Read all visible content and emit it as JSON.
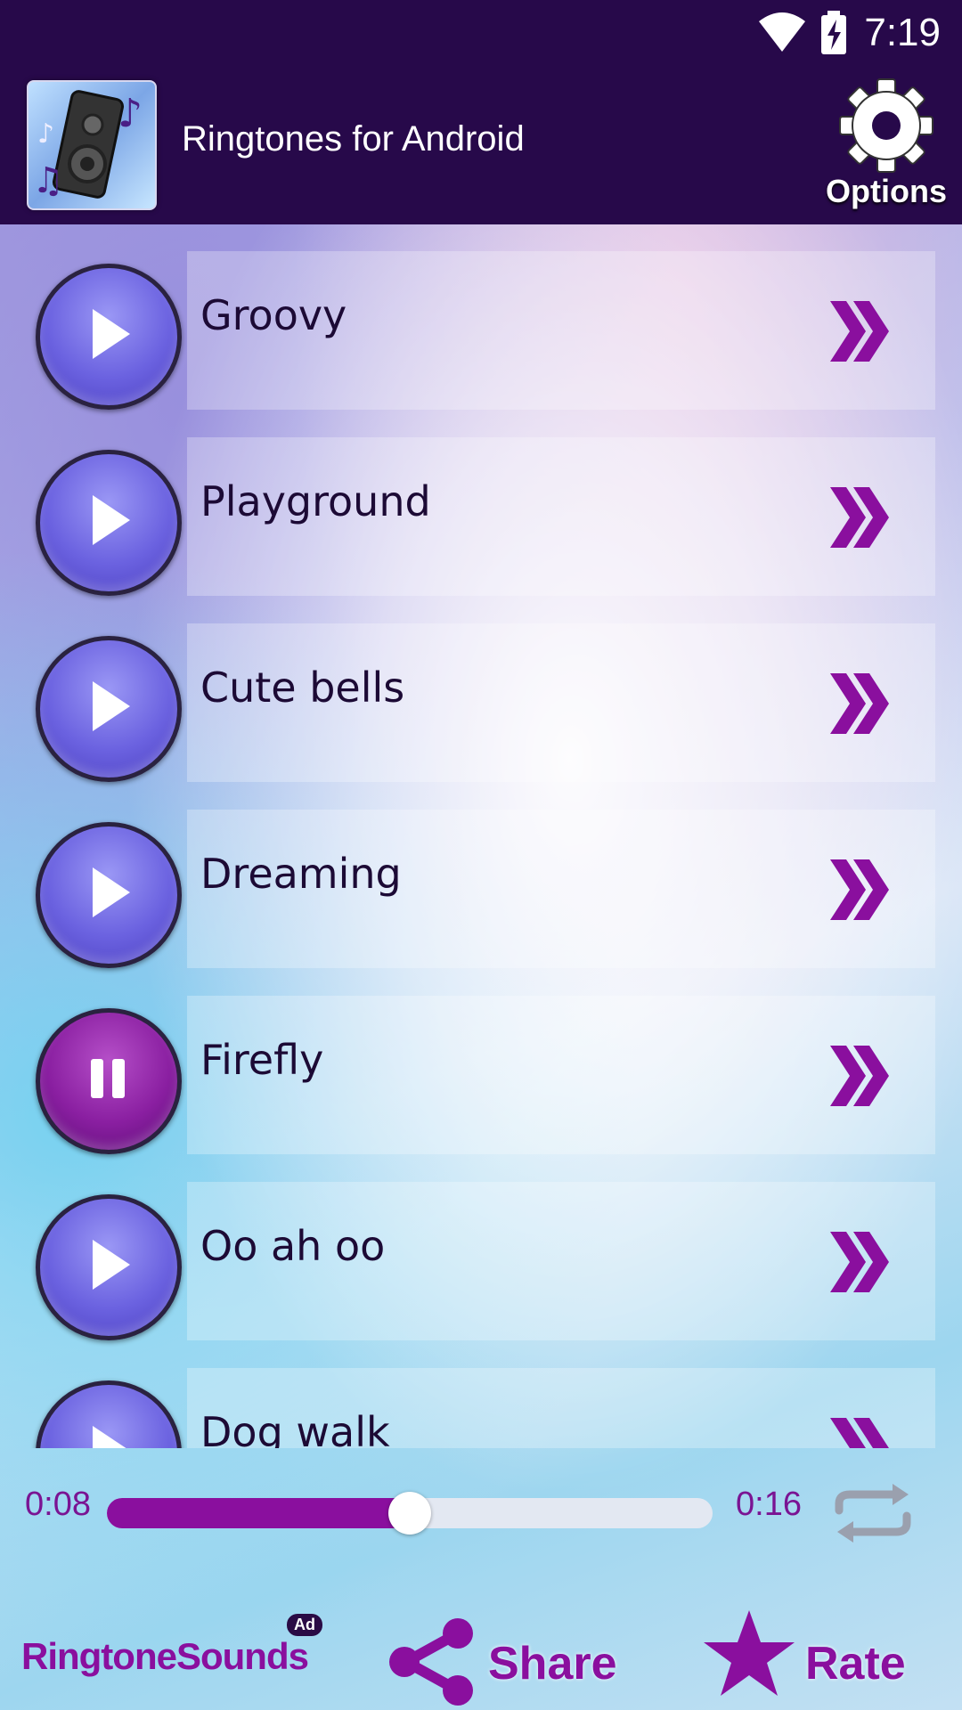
{
  "status_bar": {
    "time": "7:19"
  },
  "app_bar": {
    "title": "Ringtones for Android",
    "options_label": "Options"
  },
  "ringtones": [
    {
      "title": "Groovy",
      "state": "play"
    },
    {
      "title": "Playground",
      "state": "play"
    },
    {
      "title": "Cute bells",
      "state": "play"
    },
    {
      "title": "Dreaming",
      "state": "play"
    },
    {
      "title": "Firefly",
      "state": "pause"
    },
    {
      "title": "Oo ah oo",
      "state": "play"
    },
    {
      "title": "Dog walk",
      "state": "play"
    }
  ],
  "player": {
    "elapsed": "0:08",
    "total": "0:16",
    "progress": 0.5
  },
  "bottom_bar": {
    "ad_label": "RingtoneSounds",
    "ad_badge": "Ad",
    "share_label": "Share",
    "rate_label": "Rate"
  },
  "colors": {
    "accent": "#8a0f9e",
    "header": "#27094a",
    "play_button": "#6b62e0"
  }
}
